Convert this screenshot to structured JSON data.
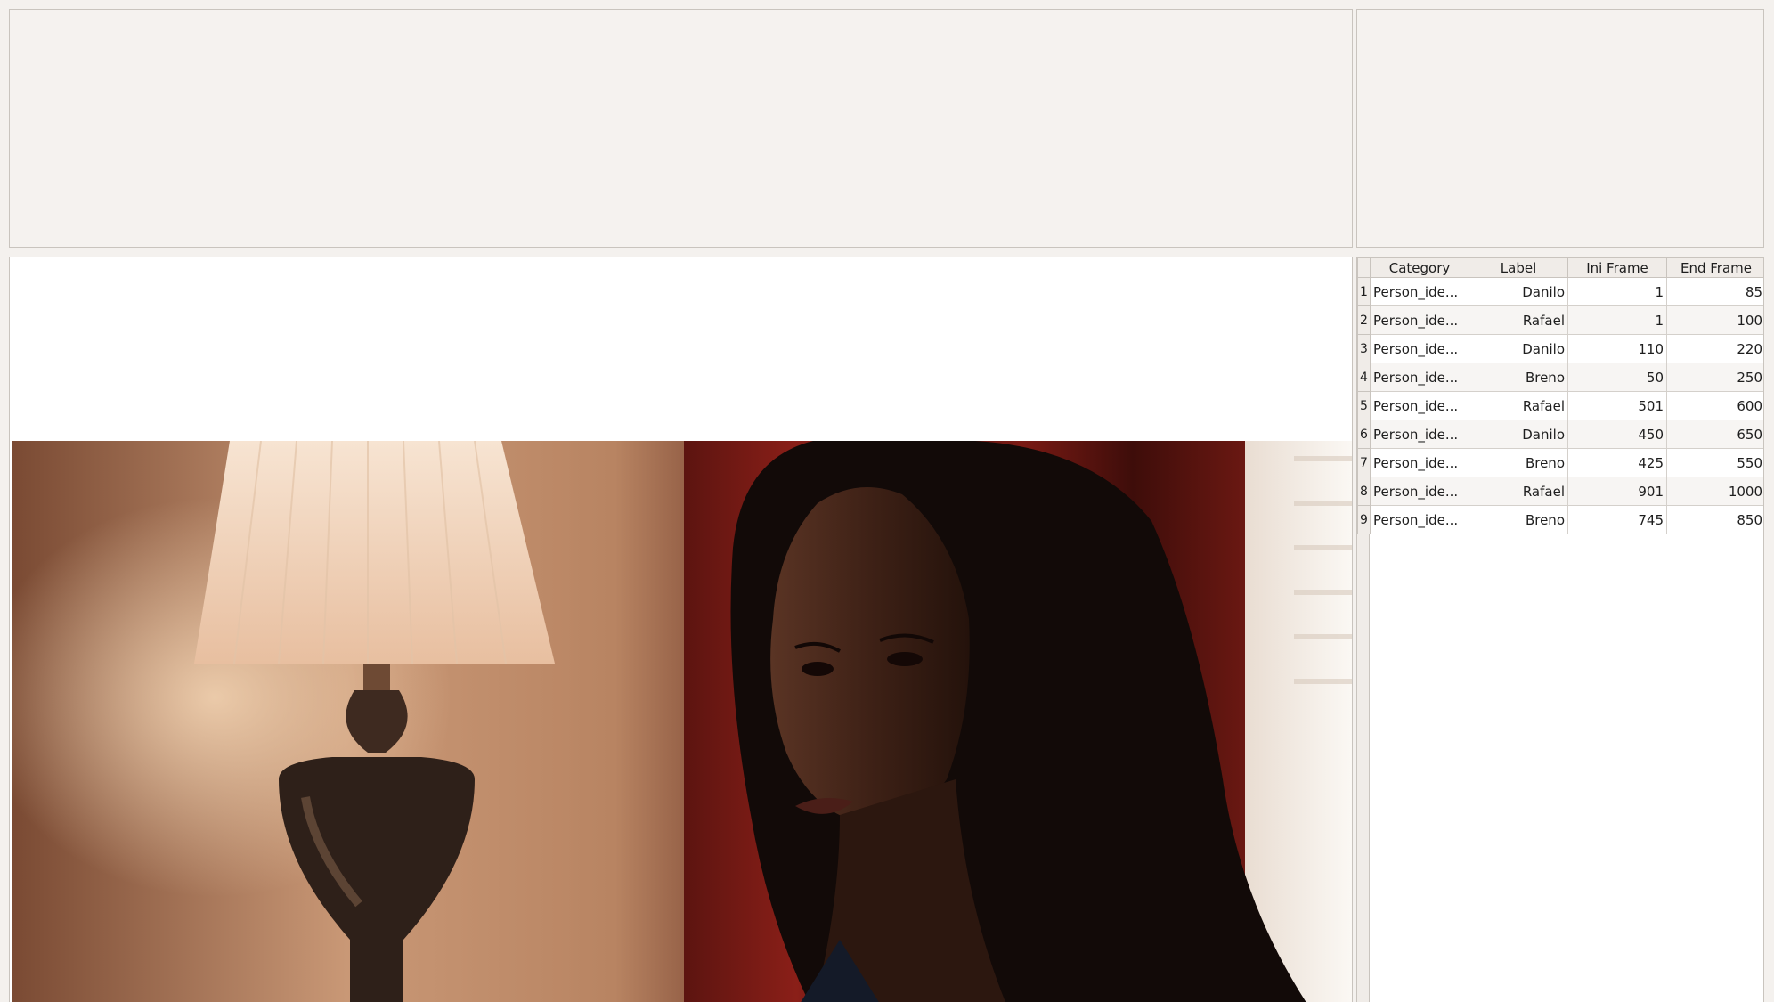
{
  "table": {
    "headers": [
      "Category",
      "Label",
      "Ini Frame",
      "End Frame"
    ],
    "rows": [
      {
        "index": "1",
        "category": "Person_ide...",
        "label": "Danilo",
        "ini": "1",
        "end": "85"
      },
      {
        "index": "2",
        "category": "Person_ide...",
        "label": "Rafael",
        "ini": "1",
        "end": "100"
      },
      {
        "index": "3",
        "category": "Person_ide...",
        "label": "Danilo",
        "ini": "110",
        "end": "220"
      },
      {
        "index": "4",
        "category": "Person_ide...",
        "label": "Breno",
        "ini": "50",
        "end": "250"
      },
      {
        "index": "5",
        "category": "Person_ide...",
        "label": "Rafael",
        "ini": "501",
        "end": "600"
      },
      {
        "index": "6",
        "category": "Person_ide...",
        "label": "Danilo",
        "ini": "450",
        "end": "650"
      },
      {
        "index": "7",
        "category": "Person_ide...",
        "label": "Breno",
        "ini": "425",
        "end": "550"
      },
      {
        "index": "8",
        "category": "Person_ide...",
        "label": "Rafael",
        "ini": "901",
        "end": "1000"
      },
      {
        "index": "9",
        "category": "Person_ide...",
        "label": "Breno",
        "ini": "745",
        "end": "850"
      }
    ]
  },
  "colors": {
    "panel_bg": "#f5f2ef",
    "border": "#c9c4be",
    "table_bg": "#ffffff"
  }
}
